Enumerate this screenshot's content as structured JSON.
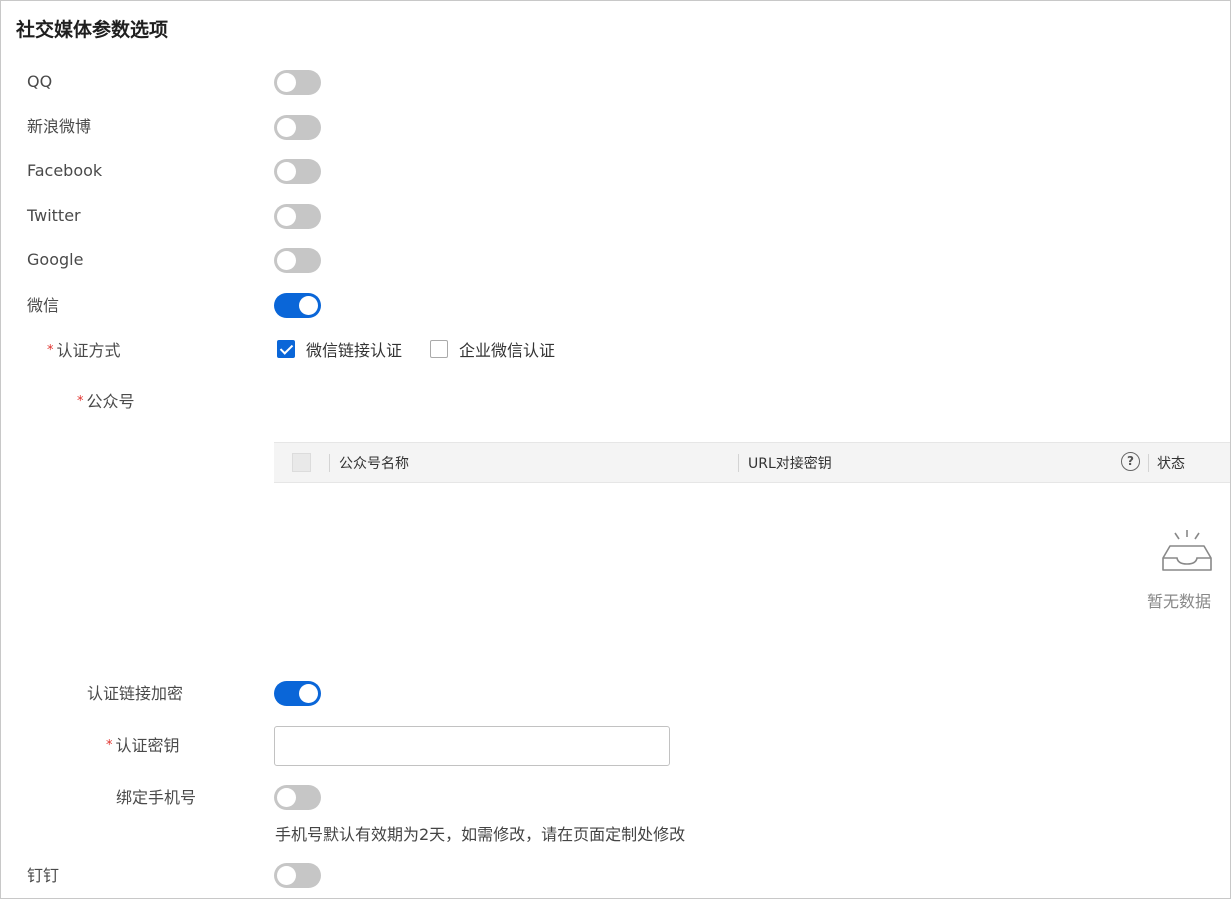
{
  "page": {
    "title": "社交媒体参数选项"
  },
  "providers": [
    {
      "label": "QQ",
      "enabled": false
    },
    {
      "label": "新浪微博",
      "enabled": false
    },
    {
      "label": "Facebook",
      "enabled": false
    },
    {
      "label": "Twitter",
      "enabled": false
    },
    {
      "label": "Google",
      "enabled": false
    },
    {
      "label": "微信",
      "enabled": true
    }
  ],
  "wechat": {
    "auth_method": {
      "required_mark": "*",
      "label": "认证方式",
      "options": [
        {
          "label": "微信链接认证",
          "checked": true
        },
        {
          "label": "企业微信认证",
          "checked": false
        }
      ]
    },
    "official_account": {
      "required_mark": "*",
      "label": "公众号",
      "table": {
        "columns": [
          "公众号名称",
          "URL对接密钥",
          "状态"
        ],
        "help_icon": "question-circle-icon",
        "empty_text": "暂无数据"
      }
    },
    "link_encryption": {
      "label": "认证链接加密",
      "enabled": true
    },
    "auth_key": {
      "required_mark": "*",
      "label": "认证密钥",
      "value": ""
    },
    "bind_phone": {
      "label": "绑定手机号",
      "enabled": false,
      "hint": "手机号默认有效期为2天，如需修改，请在页面定制处修改"
    }
  },
  "dingtalk": {
    "label": "钉钉",
    "enabled": false
  },
  "colors": {
    "accent": "#0a66d8",
    "toggle_off": "#c6c6c6",
    "required": "#e0312c"
  }
}
